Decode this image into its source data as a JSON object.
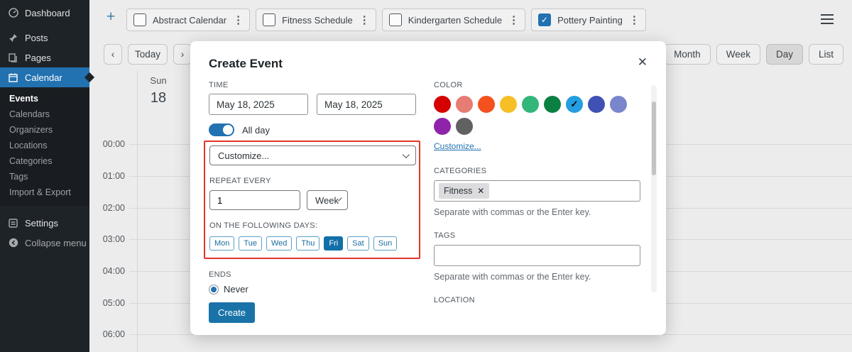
{
  "icons": {
    "check": "✓",
    "close": "✕",
    "kebab": "⋮",
    "plus": "+",
    "prev": "‹",
    "next": "›",
    "collapse_arrow": "◀"
  },
  "sidebar": {
    "items": [
      {
        "label": "Dashboard"
      },
      {
        "label": "Posts"
      },
      {
        "label": "Pages"
      },
      {
        "label": "Calendar"
      }
    ],
    "submenu": [
      "Events",
      "Calendars",
      "Organizers",
      "Locations",
      "Categories",
      "Tags",
      "Import & Export"
    ],
    "settings_label": "Settings",
    "collapse_label": "Collapse menu"
  },
  "toolbar": {
    "calendars": [
      {
        "label": "Abstract Calendar",
        "checked": false
      },
      {
        "label": "Fitness Schedule",
        "checked": false
      },
      {
        "label": "Kindergarten Schedule",
        "checked": false
      },
      {
        "label": "Pottery Painting",
        "checked": true
      }
    ]
  },
  "nav": {
    "today_label": "Today",
    "views": [
      "Month",
      "Week",
      "Day",
      "List"
    ],
    "active_view": "Day"
  },
  "calendar": {
    "day_name": "Sun",
    "day_number": "18",
    "hours": [
      "00:00",
      "01:00",
      "02:00",
      "03:00",
      "04:00",
      "05:00",
      "06:00"
    ]
  },
  "modal": {
    "title": "Create Event",
    "time": {
      "label": "TIME",
      "start_value": "May 18, 2025",
      "end_value": "May 18, 2025",
      "all_day_label": "All day",
      "all_day_on": true
    },
    "recurrence": {
      "frequency_value": "Customize...",
      "repeat_every_label": "REPEAT EVERY",
      "interval_value": "1",
      "unit_value": "Week",
      "days_label": "ON THE FOLLOWING DAYS:",
      "days": [
        "Mon",
        "Tue",
        "Wed",
        "Thu",
        "Fri",
        "Sat",
        "Sun"
      ],
      "selected_day": "Fri",
      "highlight_color": "#e5352b"
    },
    "ends": {
      "label": "ENDS",
      "option": "Never",
      "selected": true
    },
    "create_label": "Create",
    "color": {
      "label": "COLOR",
      "swatches_row1": [
        {
          "name": "red",
          "hex": "#d50000"
        },
        {
          "name": "flamingo",
          "hex": "#e67c73"
        },
        {
          "name": "orange",
          "hex": "#f4511e"
        },
        {
          "name": "yellow",
          "hex": "#f6bf26"
        },
        {
          "name": "green",
          "hex": "#33b679"
        },
        {
          "name": "dark-green",
          "hex": "#0b8043"
        },
        {
          "name": "light-blue",
          "hex": "#239ee0"
        },
        {
          "name": "blue",
          "hex": "#3f51b5"
        },
        {
          "name": "lavender",
          "hex": "#7986cb"
        }
      ],
      "swatches_row2": [
        {
          "name": "purple",
          "hex": "#8e24aa"
        },
        {
          "name": "gray",
          "hex": "#616161"
        }
      ],
      "selected_swatch": "light-blue",
      "customize_link": "Customize..."
    },
    "categories": {
      "label": "CATEGORIES",
      "chip": "Fitness",
      "helper": "Separate with commas or the Enter key."
    },
    "tags": {
      "label": "TAGS",
      "value": "",
      "helper": "Separate with commas or the Enter key."
    },
    "location": {
      "label": "LOCATION"
    },
    "accent_color": "#2271b1"
  }
}
